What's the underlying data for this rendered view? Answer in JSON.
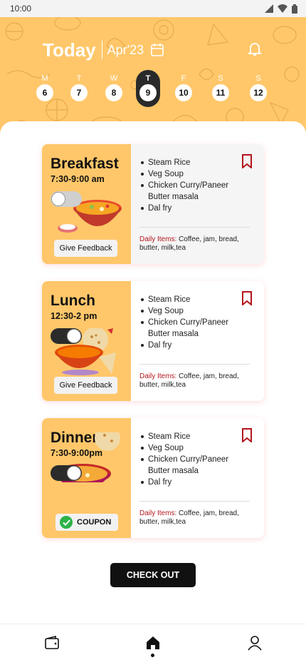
{
  "status": {
    "time": "10:00"
  },
  "header": {
    "title": "Today",
    "month": "Apr'23",
    "accent": "#ffc76a"
  },
  "days": [
    {
      "letter": "M",
      "num": "6"
    },
    {
      "letter": "T",
      "num": "7"
    },
    {
      "letter": "W",
      "num": "8"
    },
    {
      "letter": "T",
      "num": "9",
      "active": true
    },
    {
      "letter": "F",
      "num": "10"
    },
    {
      "letter": "S",
      "num": "11"
    },
    {
      "letter": "S",
      "num": "12"
    }
  ],
  "meals": [
    {
      "name": "Breakfast",
      "time": "7:30-9:00 am",
      "toggle_on": false,
      "action": "Give Feedback",
      "items": [
        "Steam Rice",
        "Veg Soup",
        "Chicken Curry/Paneer Butter masala",
        "Dal fry"
      ],
      "daily_label": "Daily Items:",
      "daily_text": " Coffee, jam, bread, butter, milk,tea"
    },
    {
      "name": "Lunch",
      "time": "12:30-2 pm",
      "toggle_on": true,
      "action": "Give Feedback",
      "items": [
        "Steam Rice",
        "Veg Soup",
        "Chicken Curry/Paneer Butter masala",
        "Dal fry"
      ],
      "daily_label": "Daily Items:",
      "daily_text": " Coffee, jam, bread, butter, milk,tea"
    },
    {
      "name": "Dinner",
      "time": "7:30-9:00pm",
      "toggle_on": true,
      "action": "COUPON",
      "items": [
        "Steam Rice",
        "Veg Soup",
        "Chicken Curry/Paneer Butter masala",
        "Dal fry"
      ],
      "daily_label": "Daily Items:",
      "daily_text": " Coffee, jam, bread, butter, milk,tea"
    }
  ],
  "checkout_label": "CHECK OUT",
  "nav": [
    {
      "icon": "wallet-icon"
    },
    {
      "icon": "home-icon",
      "active": true
    },
    {
      "icon": "profile-icon"
    }
  ],
  "colors": {
    "bookmark": "#b3151b",
    "coupon_check": "#2db34a"
  }
}
